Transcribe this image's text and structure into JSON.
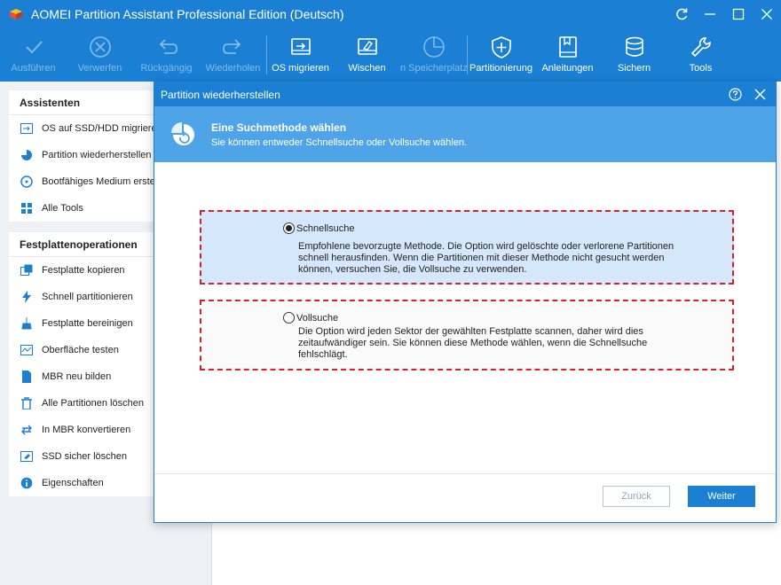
{
  "window": {
    "title": "AOMEI Partition Assistant Professional Edition (Deutsch)",
    "controls": [
      "refresh-icon",
      "minimize-icon",
      "restore-icon",
      "close-icon"
    ]
  },
  "toolbar": {
    "items": [
      {
        "label": "Ausführen",
        "icon": "check-icon",
        "enabled": false
      },
      {
        "label": "Verwerfen",
        "icon": "discard-icon",
        "enabled": false
      },
      {
        "label": "Rückgängig",
        "icon": "undo-icon",
        "enabled": false
      },
      {
        "label": "Wiederholen",
        "icon": "redo-icon",
        "enabled": false
      },
      {
        "label": "OS migrieren",
        "icon": "migrate-os-icon",
        "enabled": true
      },
      {
        "label": "Wischen",
        "icon": "wipe-icon",
        "enabled": true
      },
      {
        "label": "n Speicherplatz ver",
        "icon": "space-analyzer-icon",
        "enabled": false
      },
      {
        "label": "Partitionierung",
        "icon": "shield-plus-icon",
        "enabled": true
      },
      {
        "label": "Anleitungen",
        "icon": "book-icon",
        "enabled": true
      },
      {
        "label": "Sichern",
        "icon": "backup-icon",
        "enabled": true
      },
      {
        "label": "Tools",
        "icon": "wrench-icon",
        "enabled": true
      }
    ]
  },
  "sidebar": {
    "wizards": {
      "title": "Assistenten",
      "items": [
        {
          "label": "OS auf SSD/HDD migrieren",
          "icon": "migrate-icon"
        },
        {
          "label": "Partition wiederherstellen",
          "icon": "recover-icon"
        },
        {
          "label": "Bootfähiges Medium erstellen",
          "icon": "boot-media-icon"
        },
        {
          "label": "Alle Tools",
          "icon": "all-tools-icon"
        }
      ]
    },
    "disk_ops": {
      "title": "Festplattenoperationen",
      "items": [
        {
          "label": "Festplatte kopieren",
          "icon": "copy-disk-icon"
        },
        {
          "label": "Schnell partitionieren",
          "icon": "lightning-icon"
        },
        {
          "label": "Festplatte bereinigen",
          "icon": "broom-icon"
        },
        {
          "label": "Oberfläche testen",
          "icon": "surface-test-icon"
        },
        {
          "label": "MBR neu bilden",
          "icon": "mbr-icon"
        },
        {
          "label": "Alle Partitionen löschen",
          "icon": "trash-icon"
        },
        {
          "label": "In MBR konvertieren",
          "icon": "convert-icon"
        },
        {
          "label": "SSD sicher löschen",
          "icon": "ssd-erase-icon"
        },
        {
          "label": "Eigenschaften",
          "icon": "info-icon"
        }
      ]
    }
  },
  "dialog": {
    "title": "Partition wiederherstellen",
    "header_title": "Eine Suchmethode wählen",
    "header_subtitle": "Sie können entweder Schnellsuche oder Vollsuche wählen.",
    "options": {
      "quick": {
        "label": "Schnellsuche",
        "selected": true,
        "description": "Empfohlene bevorzugte Methode. Die Option wird gelöschte oder verlorene Partitionen schnell herausfinden. Wenn die Partitionen mit dieser Methode nicht gesucht werden können, versuchen Sie, die Vollsuche zu verwenden."
      },
      "full": {
        "label": "Vollsuche",
        "selected": false,
        "description": "Die Option wird jeden Sektor der gewählten Festplatte scannen, daher wird dies zeitaufwändiger sein. Sie können diese Methode wählen, wenn die Schnellsuche fehlschlägt."
      }
    },
    "back_label": "Zurück",
    "next_label": "Weiter"
  },
  "colors": {
    "accent": "#1b80d4",
    "header": "#4fa4e8",
    "highlight_border": "#d8202a",
    "selected_option_bg": "#d5e7fa"
  }
}
